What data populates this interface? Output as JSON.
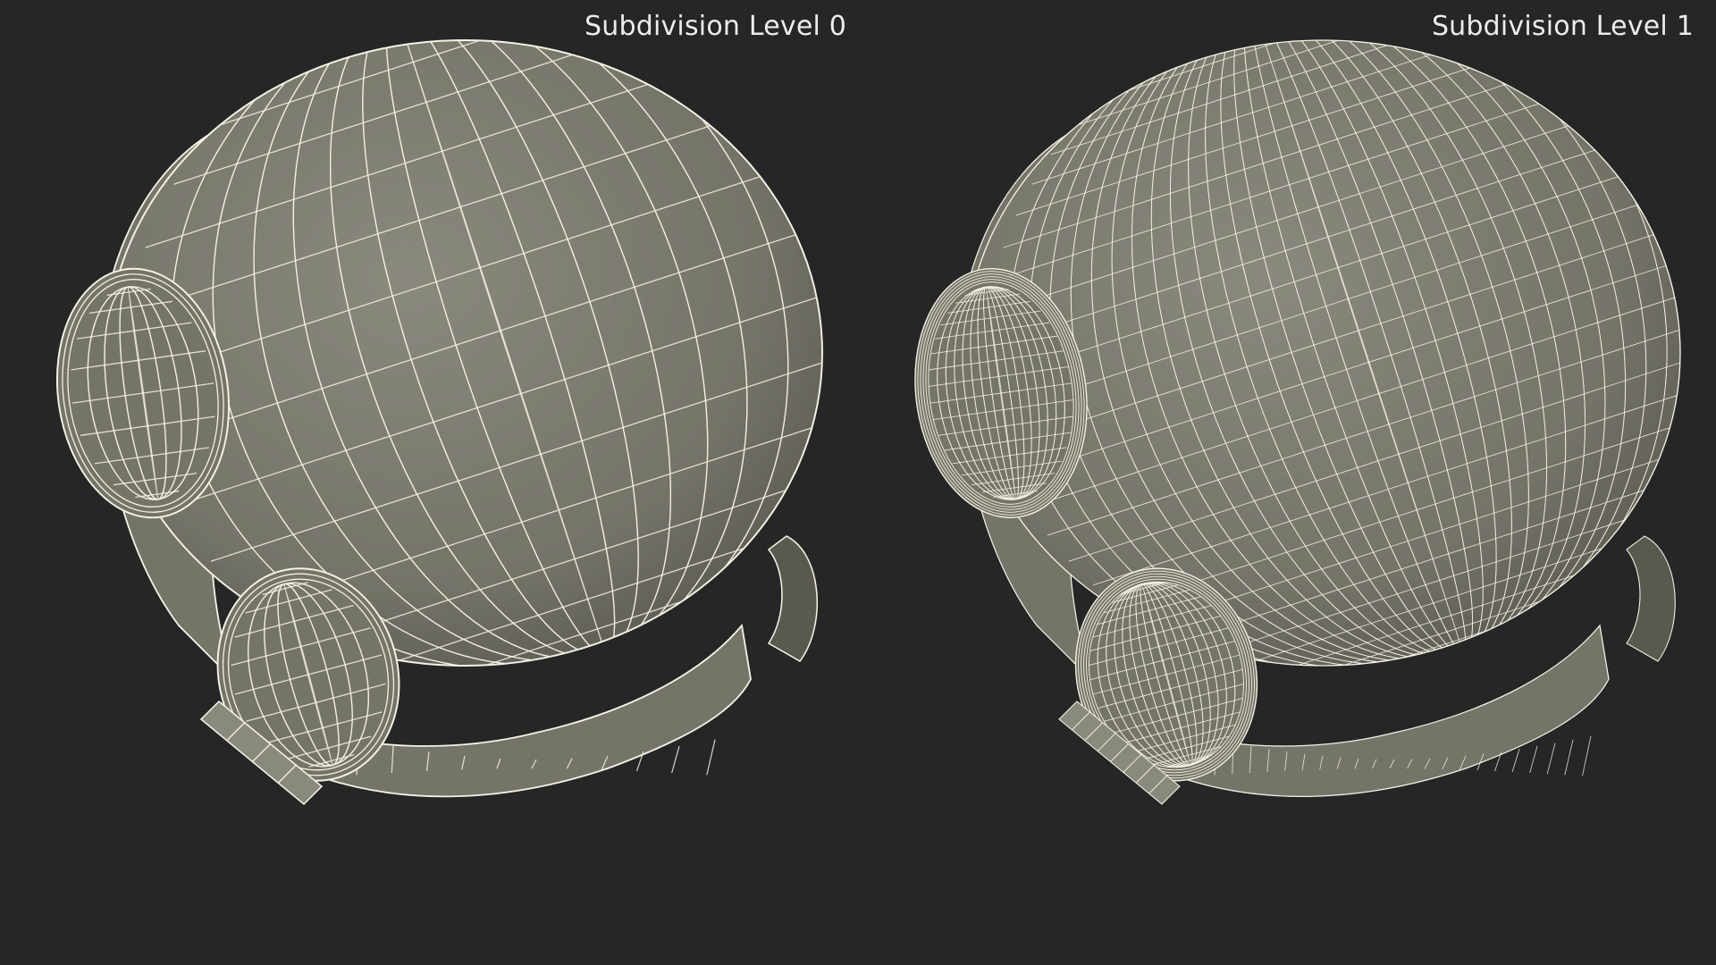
{
  "labels": {
    "left": "Subdivision Level 0",
    "right": "Subdivision Level 1"
  },
  "colors": {
    "background": "#262626",
    "surface": "#757469",
    "surface_light": "#8a897e",
    "surface_dark": "#5a5950",
    "wire": "#f4f2e4",
    "label": "#ececec"
  }
}
